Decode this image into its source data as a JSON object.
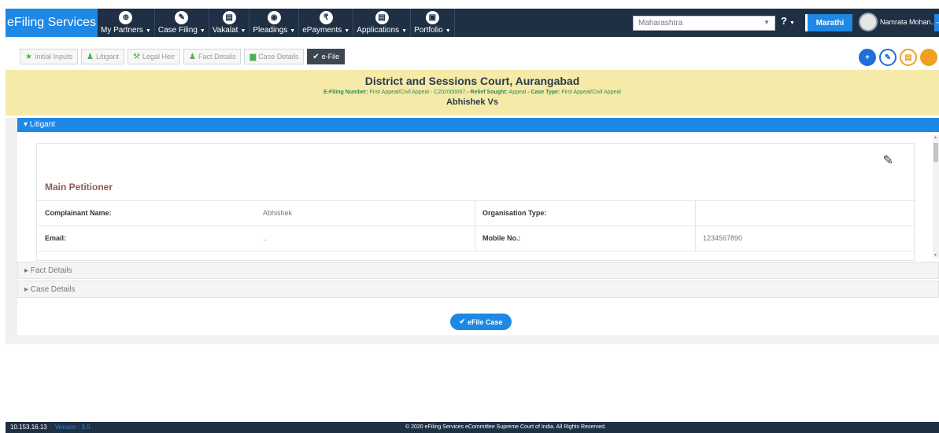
{
  "nav": {
    "brand": "eFiling Services",
    "items": [
      {
        "label": "My Partners",
        "icon": "partners-icon",
        "glyph": "⊕"
      },
      {
        "label": "Case Filing",
        "icon": "case-filing-icon",
        "glyph": "✎"
      },
      {
        "label": "Vakalat",
        "icon": "vakalat-icon",
        "glyph": "▤"
      },
      {
        "label": "Pleadings",
        "icon": "pleadings-icon",
        "glyph": "◉"
      },
      {
        "label": "ePayments",
        "icon": "rupee-icon",
        "glyph": "₹"
      },
      {
        "label": "Applications",
        "icon": "applications-icon",
        "glyph": "▤"
      },
      {
        "label": "Portfolio",
        "icon": "portfolio-icon",
        "glyph": "▣"
      }
    ],
    "state": "Maharashtra",
    "help": "?",
    "language": "Marathi",
    "user": "Namrata Mohan..."
  },
  "tabs": [
    {
      "label": "Initial Inputs",
      "icon": "star-icon",
      "glyph": "★"
    },
    {
      "label": "Litigant",
      "icon": "user-icon",
      "glyph": "♟"
    },
    {
      "label": "Legal Heir",
      "icon": "gavel-icon",
      "glyph": "⚒"
    },
    {
      "label": "Fact Details",
      "icon": "user-icon",
      "glyph": "♟"
    },
    {
      "label": "Case Details",
      "icon": "document-icon",
      "glyph": "▆"
    },
    {
      "label": "e-File",
      "icon": "check-circle-icon",
      "glyph": "✔"
    }
  ],
  "banner": {
    "court": "District and Sessions Court, Aurangabad",
    "filing_label": "E-Filing Number:",
    "filing_number": "First Appeal/Civil Appeal - C202000067",
    "relief_label": "- Relief Sought:",
    "relief": "Appeal",
    "case_type_label": "- Case Type:",
    "case_type": "First Appeal/Civil Appeal",
    "party": "Abhishek Vs"
  },
  "litigant": {
    "header": "▾ Litigant",
    "section_title": "Main Petitioner",
    "rows": [
      {
        "label1": "Complainant Name:",
        "value1": "Abhishek",
        "label2": "Organisation Type:",
        "value2": ""
      },
      {
        "label1": "Email:",
        "value1": "..",
        "label2": "Mobile No.:",
        "value2": "1234567890"
      }
    ]
  },
  "sections": {
    "fact_details": "▸ Fact Details",
    "case_details": "▸ Case Details"
  },
  "efile_button": "eFile Case",
  "footer": {
    "ip": "10.153.16.13",
    "version": "Version : 3.0",
    "copyright": "© 2020 eFiling Services eCommittee Supreme Court of India. All Rights Reserved."
  },
  "colors": {
    "nav_bg": "#1f2f44",
    "accent": "#1e88e5",
    "banner_bg": "#f5eaa8"
  }
}
